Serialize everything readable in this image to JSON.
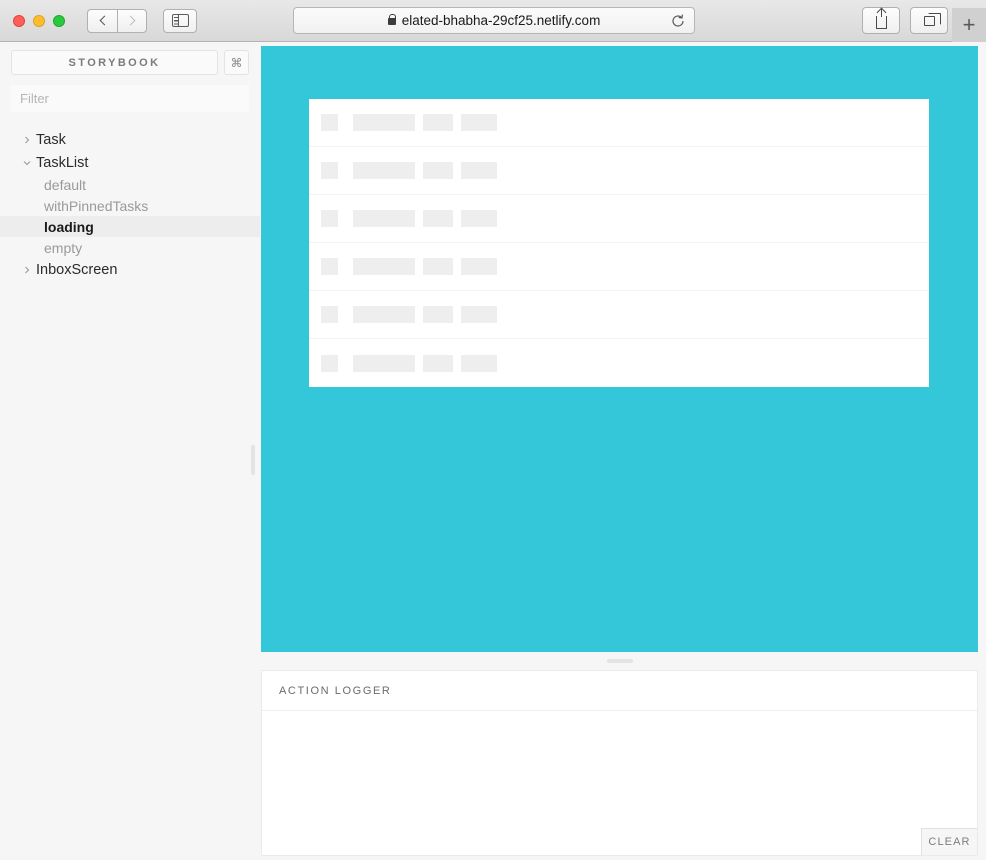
{
  "browser": {
    "window_controls": [
      "close",
      "minimize",
      "maximize"
    ],
    "back_label": "Back",
    "forward_label": "Forward",
    "sidebar_toggle_label": "Show sidebar",
    "url": "elated-bhabha-29cf25.netlify.com",
    "secure_icon": "lock-icon",
    "reload_label": "Reload",
    "share_label": "Share",
    "tabs_label": "Show tab overview",
    "new_tab_label": "+"
  },
  "sidebar": {
    "brand": "STORYBOOK",
    "shortcut_button": "⌘",
    "filter": {
      "value": "",
      "placeholder": "Filter"
    },
    "tree": [
      {
        "label": "Task",
        "type": "root",
        "expanded": false,
        "selected": false
      },
      {
        "label": "TaskList",
        "type": "root",
        "expanded": true,
        "selected": false
      },
      {
        "label": "default",
        "type": "leaf",
        "selected": false
      },
      {
        "label": "withPinnedTasks",
        "type": "leaf",
        "selected": false
      },
      {
        "label": "loading",
        "type": "leaf",
        "selected": true
      },
      {
        "label": "empty",
        "type": "leaf",
        "selected": false
      },
      {
        "label": "InboxScreen",
        "type": "root",
        "expanded": false,
        "selected": false
      }
    ],
    "resize_handle": "sidebar-resize-handle"
  },
  "preview": {
    "background_color": "#34c7da",
    "story": "loading",
    "card_background": "#ffffff",
    "skeleton_color": "#eeeeee",
    "row_count": 6,
    "skeleton_widths": [
      17,
      62,
      30,
      36
    ]
  },
  "addons": {
    "tabs": [
      {
        "label": "ACTION LOGGER",
        "active": true
      }
    ],
    "log_entries": [],
    "clear_label": "CLEAR"
  }
}
